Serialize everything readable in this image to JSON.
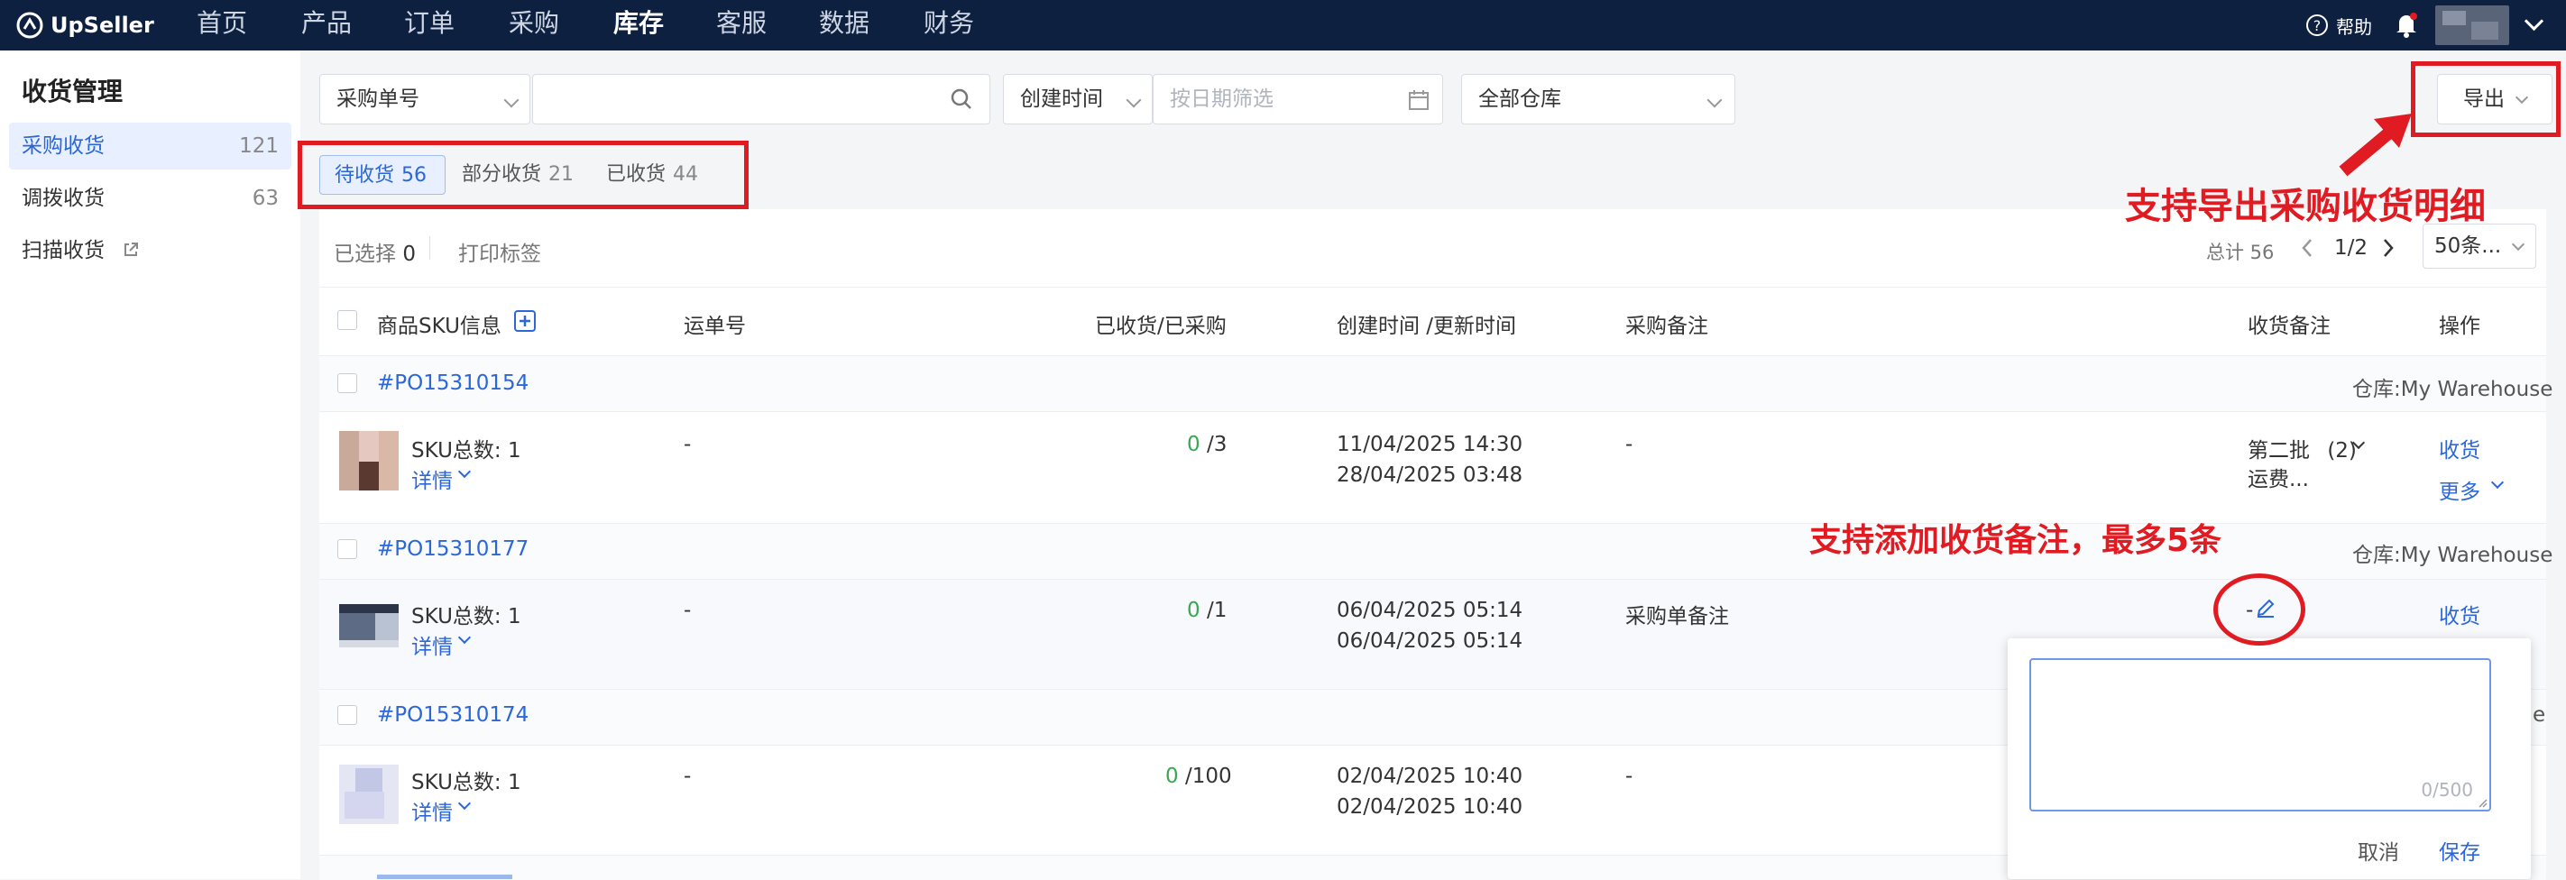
{
  "app": {
    "logo": "UpSeller"
  },
  "nav": {
    "items": [
      "首页",
      "产品",
      "订单",
      "采购",
      "库存",
      "客服",
      "数据",
      "财务"
    ],
    "help": "帮助"
  },
  "sidebar": {
    "title": "收货管理",
    "items": [
      {
        "label": "采购收货",
        "count": "121"
      },
      {
        "label": "调拨收货",
        "count": "63"
      },
      {
        "label": "扫描收货",
        "count": ""
      }
    ]
  },
  "filters": {
    "search_type": "采购单号",
    "search_placeholder": "",
    "time_type": "创建时间",
    "date_placeholder": "按日期筛选",
    "warehouse": "全部仓库",
    "export_label": "导出"
  },
  "tabs": [
    {
      "label": "待收货",
      "count": "56"
    },
    {
      "label": "部分收货",
      "count": "21"
    },
    {
      "label": "已收货",
      "count": "44"
    }
  ],
  "toolbar": {
    "selected_label": "已选择",
    "selected_count": "0",
    "print_label": "打印标签",
    "total": "总计 56",
    "page": "1/2",
    "page_size": "50条..."
  },
  "columns": {
    "sku_info": "商品SKU信息",
    "tracking": "运单号",
    "received": "已收货/已采购",
    "time": "创建时间 /更新时间",
    "purchase_note": "采购备注",
    "receive_note": "收货备注",
    "action": "操作"
  },
  "orders": [
    {
      "po": "#PO15310154",
      "warehouse": "仓库:My Warehouse",
      "sku_count": "SKU总数: 1",
      "detail": "详情",
      "tracking": "-",
      "received": "0",
      "purchased": "/3",
      "created": "11/04/2025 14:30",
      "updated": "28/04/2025 03:48",
      "purchase_note": "-",
      "receive_note_1": "第二批",
      "receive_note_count": "(2)",
      "receive_note_2": "运费...",
      "action": "收货",
      "more": "更多"
    },
    {
      "po": "#PO15310177",
      "warehouse": "仓库:My Warehouse",
      "sku_count": "SKU总数: 1",
      "detail": "详情",
      "tracking": "-",
      "received": "0",
      "purchased": "/1",
      "created": "06/04/2025 05:14",
      "updated": "06/04/2025 05:14",
      "purchase_note": "采购单备注",
      "receive_note_1": "-",
      "action": "收货"
    },
    {
      "po": "#PO15310174",
      "warehouse": "e",
      "sku_count": "SKU总数: 1",
      "detail": "详情",
      "tracking": "-",
      "received": "0",
      "purchased": "/100",
      "created": "02/04/2025 10:40",
      "updated": "02/04/2025 10:40",
      "purchase_note": "-"
    }
  ],
  "popover": {
    "counter": "0/500",
    "cancel": "取消",
    "save": "保存"
  },
  "annotations": {
    "export_note": "支持导出采购收货明细",
    "remark_note": "支持添加收货备注，最多5条"
  },
  "colors": {
    "nav_bg": "#0d2040",
    "accent": "#2b67d9",
    "annotation": "#e11b22",
    "received_green": "#3aa656"
  }
}
